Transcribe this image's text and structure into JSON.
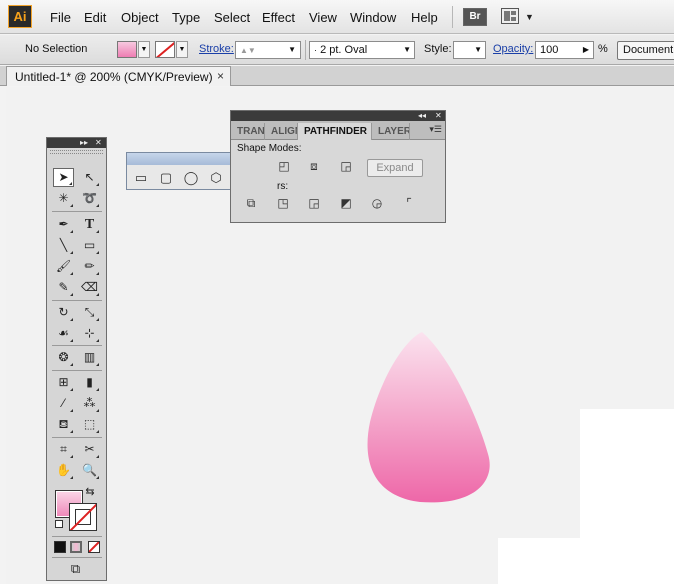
{
  "app": {
    "logo": "Ai"
  },
  "menu": [
    "File",
    "Edit",
    "Object",
    "Type",
    "Select",
    "Effect",
    "View",
    "Window",
    "Help"
  ],
  "bridge_button": "Br",
  "control": {
    "selection": "No Selection",
    "stroke_label": "Stroke:",
    "brush_value": "2 pt. Oval",
    "style_label": "Style:",
    "opacity_label": "Opacity:",
    "opacity_value": "100",
    "percent": "%",
    "document_button": "Document S"
  },
  "document_tab": {
    "title": "Untitled-1* @ 200% (CMYK/Preview)",
    "close": "×"
  },
  "pathfinder": {
    "tabs": [
      "TRAN",
      "ALIGN",
      "PATHFINDER",
      "LAYERS"
    ],
    "active_tab": "PATHFINDER",
    "shape_modes_label": "Shape Modes:",
    "pathfinders_label": "rs:",
    "expand_label": "Expand"
  },
  "toolbox": {
    "fill_color": "#f7b3d2",
    "stroke": "none"
  },
  "artwork": {
    "shape": "drop",
    "gradient_top": "#fbe0ee",
    "gradient_bottom": "#ef6aa9"
  },
  "colors": {
    "accent": "#f7a21b",
    "link": "#1a3fa8"
  }
}
